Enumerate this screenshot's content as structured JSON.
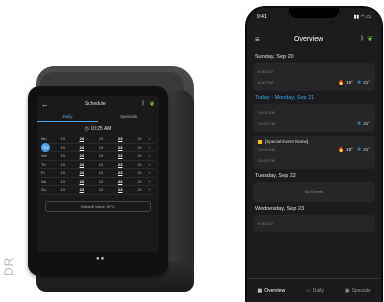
{
  "device": {
    "screen_title": "Schedule",
    "tabs": [
      "Daily",
      "Specials"
    ],
    "time": "10:25 AM",
    "rows": [
      {
        "day": "Mo",
        "v": [
          "19",
          "23",
          "19",
          "23",
          "19"
        ]
      },
      {
        "day": "Tu",
        "v": [
          "19",
          "23",
          "19",
          "23",
          "19"
        ],
        "highlight": true
      },
      {
        "day": "We",
        "v": [
          "19",
          "23",
          "19",
          "23",
          "19"
        ]
      },
      {
        "day": "Th",
        "v": [
          "19",
          "23",
          "19",
          "23",
          "19"
        ]
      },
      {
        "day": "Fr",
        "v": [
          "19",
          "23",
          "19",
          "23",
          "19"
        ]
      },
      {
        "day": "Sa",
        "v": [
          "19",
          "23",
          "19",
          "23",
          "19"
        ]
      },
      {
        "day": "Su",
        "v": [
          "19",
          "23",
          "19",
          "23",
          "19"
        ]
      }
    ],
    "default_value": "Default Value  19°C",
    "vertical_text": "DR"
  },
  "phone": {
    "clock": "9:41",
    "title": "Overview",
    "sections": [
      {
        "title": "Sunday, Sep 20",
        "times": [
          "6:00 AM",
          "6:00 PM"
        ],
        "t1": "19°",
        "t2": "21°"
      },
      {
        "title": "Today - Monday, Sep 21",
        "times": [
          "10:00 AM",
          "10:00 PM"
        ],
        "t2": "21°"
      },
      {
        "event": "[Special Event Name]",
        "times": [
          "10:00 AM",
          "12:00 PM"
        ],
        "t1": "19°",
        "t2": "21°"
      },
      {
        "title": "Tuesday, Sep 22",
        "empty": "No Events"
      },
      {
        "title": "Wednesday, Sep 23",
        "times": [
          "6:00 AM"
        ]
      }
    ],
    "nav": [
      "Overview",
      "Daily",
      "Specials"
    ]
  }
}
